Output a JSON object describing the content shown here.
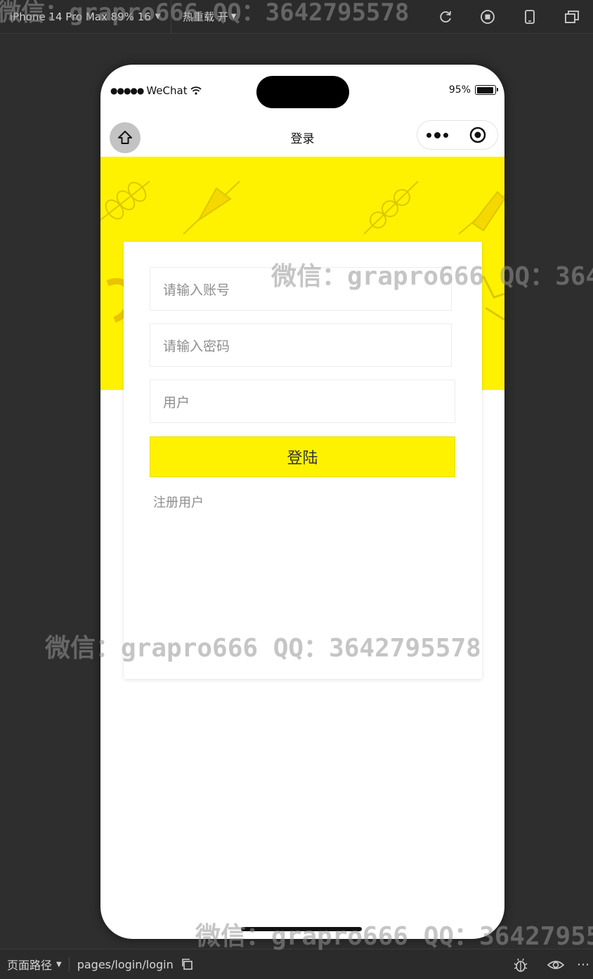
{
  "devtools": {
    "device": "iPhone 14 Pro Max 89% 16",
    "hot_reload": "热重载 开"
  },
  "status_bar": {
    "signal": "●●●●●",
    "carrier": "WeChat",
    "battery": "95%",
    "battery_level": 0.95
  },
  "navbar": {
    "title": "登录"
  },
  "form": {
    "account_placeholder": "请输入账号",
    "password_placeholder": "请输入密码",
    "role_value": "用户",
    "login_label": "登陆",
    "register_label": "注册用户"
  },
  "bottom": {
    "path_label": "页面路径",
    "path": "pages/login/login"
  },
  "watermark": {
    "text": "微信：grapro666 QQ：3642795578"
  },
  "colors": {
    "accent": "#fff200",
    "background": "#2e2e2e"
  }
}
